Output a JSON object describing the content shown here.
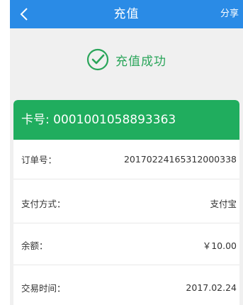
{
  "header": {
    "title": "充值",
    "share_label": "分享"
  },
  "status": {
    "text": "充值成功"
  },
  "card": {
    "card_number_label": "卡号:",
    "card_number": "0001001058893363",
    "rows": [
      {
        "label": "订单号：",
        "value": "20170224165312000338"
      },
      {
        "label": "支付方式：",
        "value": "支付宝"
      },
      {
        "label": "余额：",
        "value": "￥10.00"
      },
      {
        "label": "交易时间：",
        "value": "2017.02.24"
      }
    ]
  },
  "colors": {
    "topbar": "#2a8be6",
    "success_green": "#2aa55a",
    "card_header_green": "#20ad5e"
  },
  "icons": {
    "back": "chevron-left-icon",
    "success": "check-circle-icon"
  }
}
